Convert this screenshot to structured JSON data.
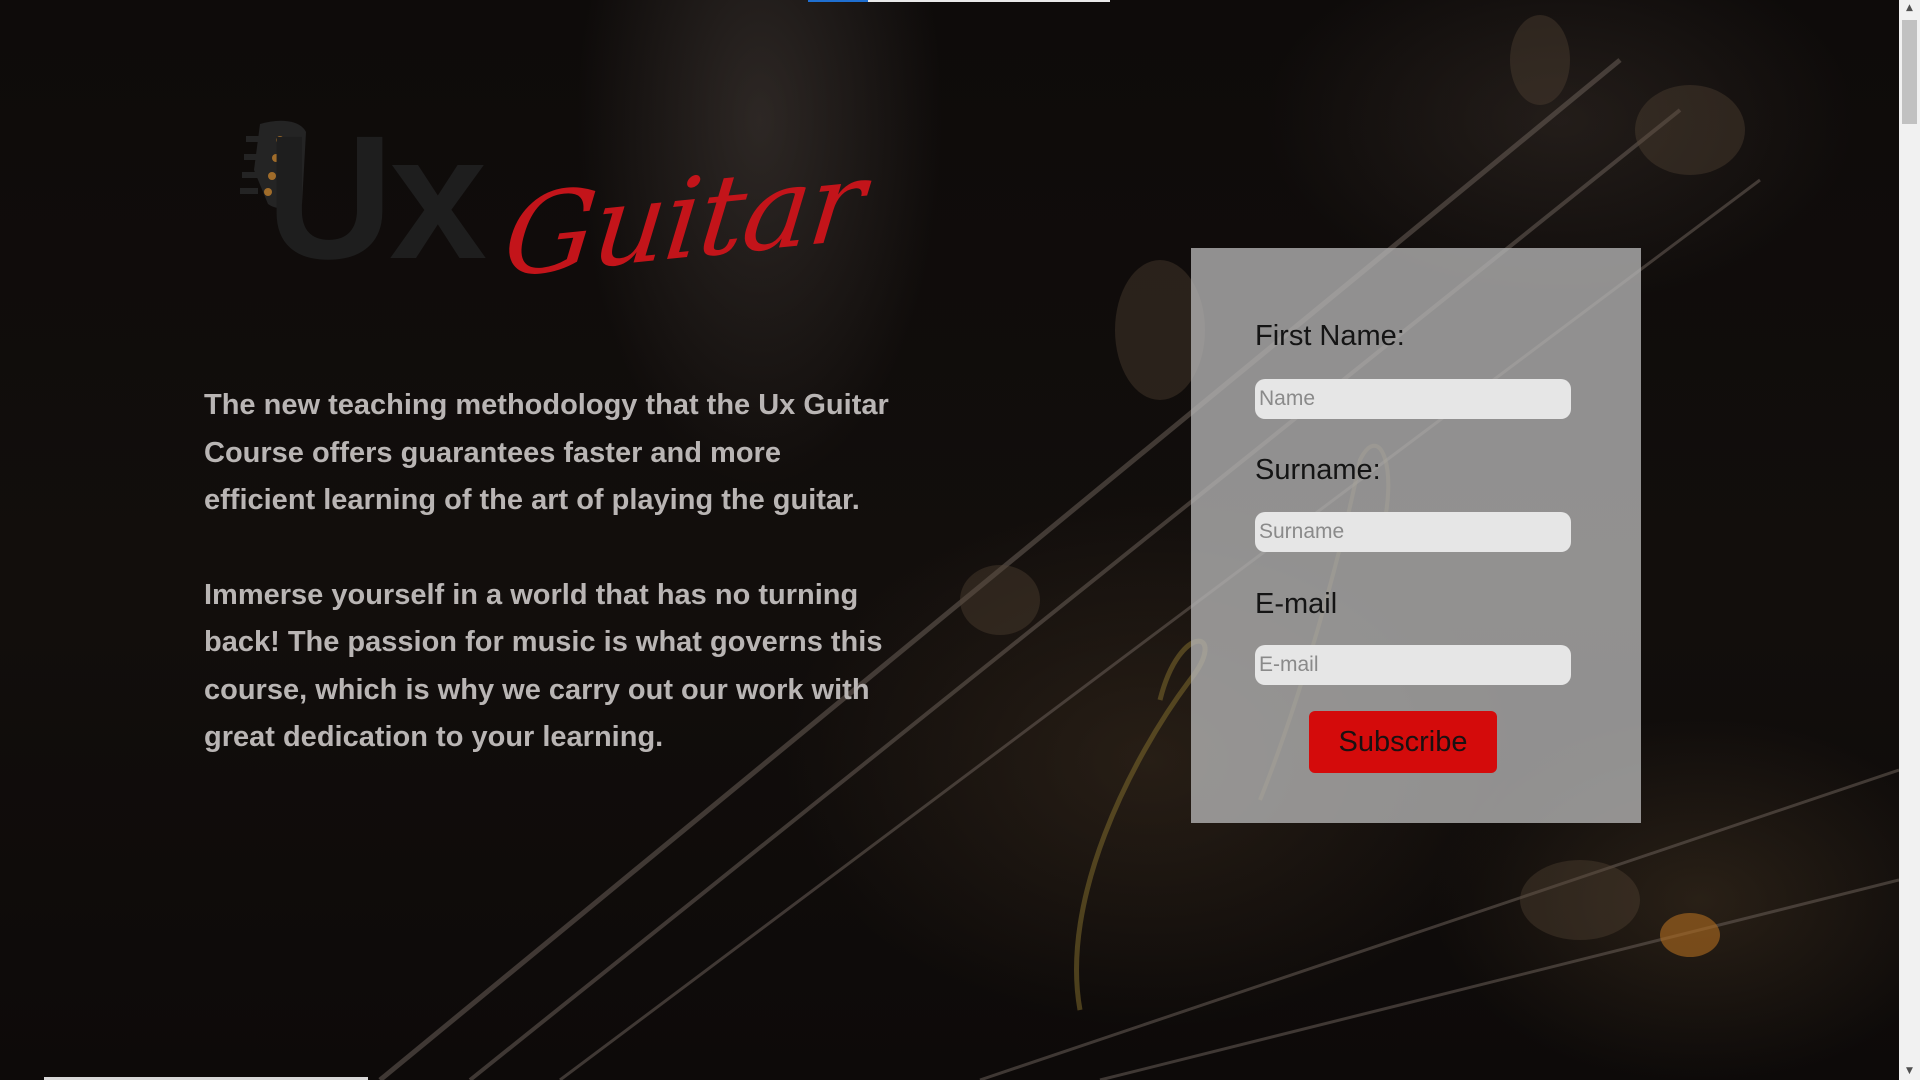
{
  "logo": {
    "ux": "Ux",
    "guitar": "Guitar",
    "icon": "guitar-headstock-icon"
  },
  "copy": {
    "paragraph_1": "The new teaching methodology that the Ux Guitar Course offers guarantees faster and more efficient learning of the art of playing the guitar.",
    "paragraph_2": "Immerse yourself in a world that has no turning back! The passion for music is what governs this course, which is why we carry out our work with great dedication to your learning."
  },
  "form": {
    "first_name_label": "First Name:",
    "first_name_placeholder": "Name",
    "surname_label": "Surname:",
    "surname_placeholder": "Surname",
    "email_label": "E-mail",
    "email_placeholder": "E-mail",
    "subscribe_label": "Subscribe"
  },
  "scrollbar": {
    "up_icon": "arrow-up-icon",
    "down_icon": "arrow-down-icon"
  },
  "colors": {
    "accent_red": "#d40b0b",
    "logo_red": "#c3141a",
    "card_bg": "#b6b6b6",
    "text_light": "#b9b5b4"
  }
}
